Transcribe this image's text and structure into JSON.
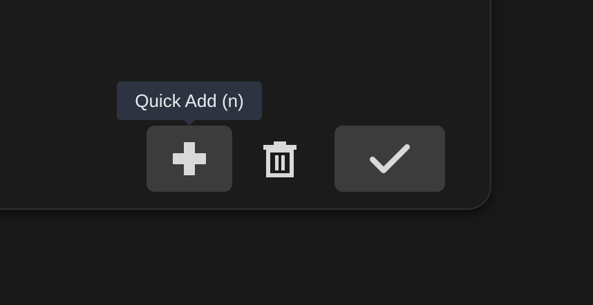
{
  "toolbar": {
    "quick_add": {
      "icon": "plus-icon",
      "tooltip": "Quick Add (n)"
    },
    "delete": {
      "icon": "trash-icon"
    },
    "confirm": {
      "icon": "checkmark-icon"
    }
  },
  "colors": {
    "background": "#191919",
    "button_fill": "#3c3c3c",
    "icon": "#d9d9d9",
    "tooltip_bg": "#2d3340",
    "tooltip_text": "#e9ebef"
  }
}
